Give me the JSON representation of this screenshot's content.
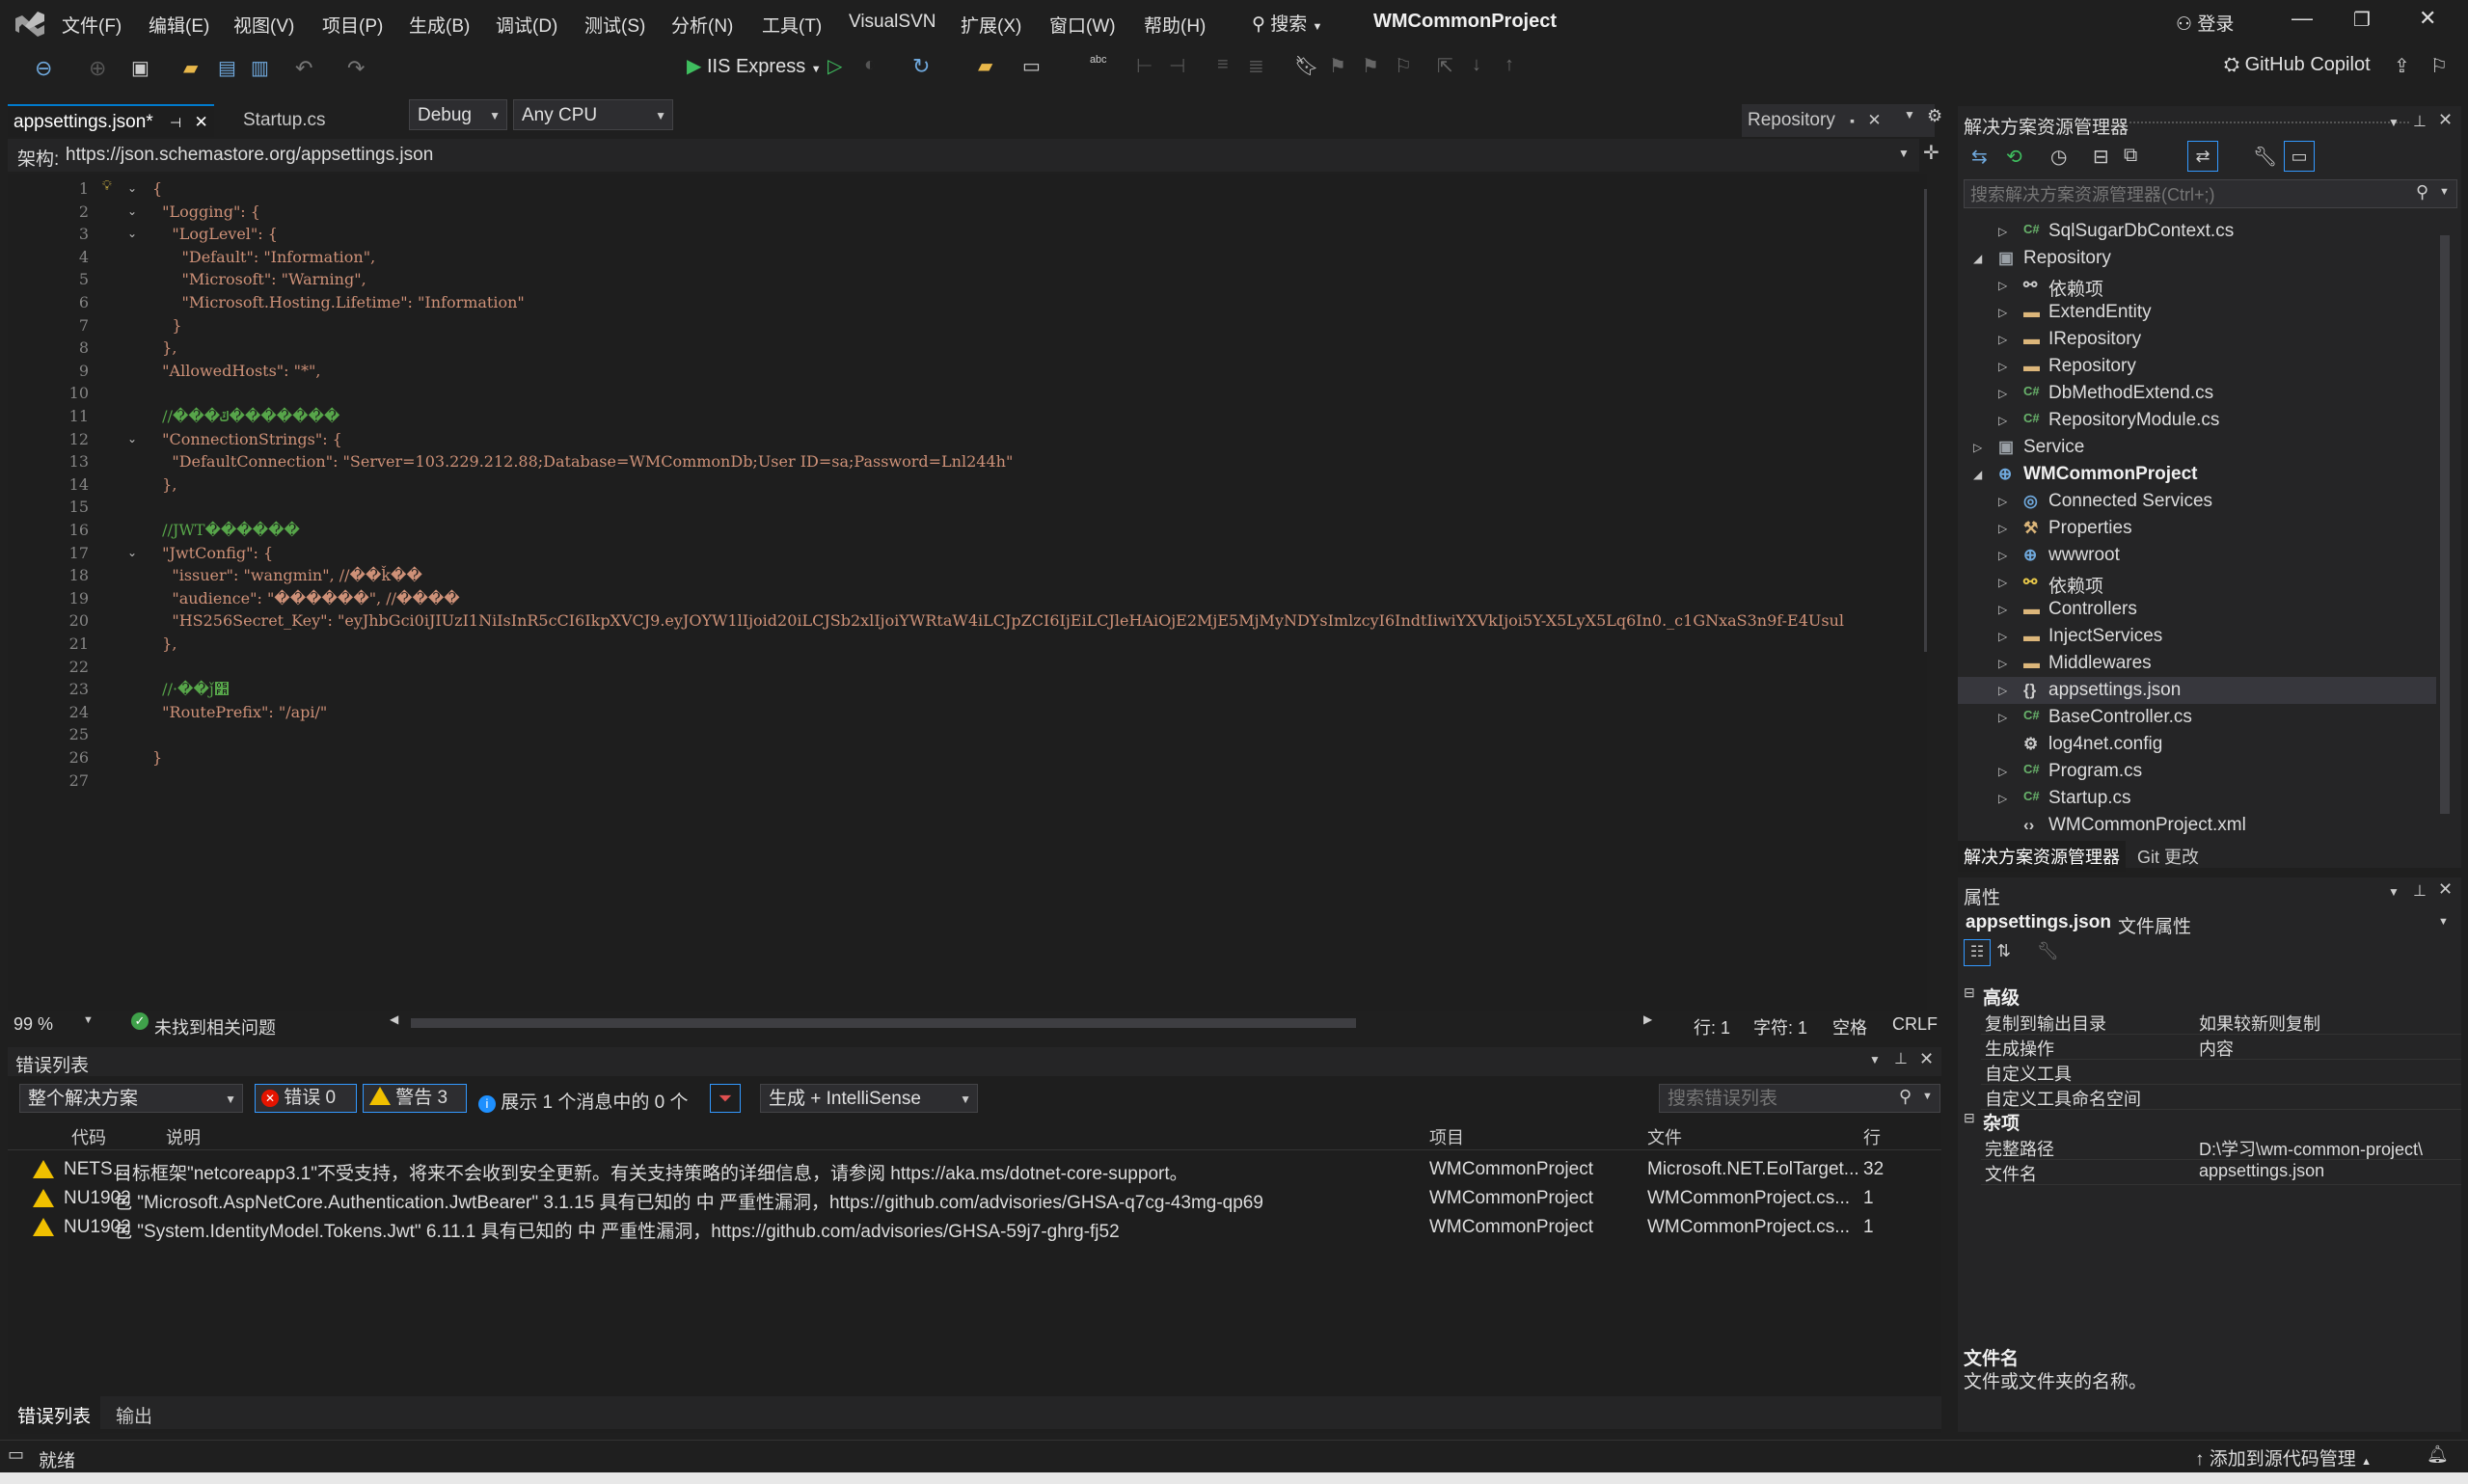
{
  "menu": [
    "文件(F)",
    "编辑(E)",
    "视图(V)",
    "项目(P)",
    "生成(B)",
    "调试(D)",
    "测试(S)",
    "分析(N)",
    "工具(T)",
    "VisualSVN",
    "扩展(X)",
    "窗口(W)",
    "帮助(H)"
  ],
  "search_label": "搜索",
  "project_title": "WMCommonProject",
  "login_label": "登录",
  "copilot_label": "GitHub Copilot",
  "toolbar": {
    "config": "Debug",
    "platform": "Any CPU",
    "run_target": "IIS Express"
  },
  "editor": {
    "tabs": [
      {
        "label": "appsettings.json*",
        "active": true
      },
      {
        "label": "Startup.cs",
        "active": false
      }
    ],
    "repository_label": "Repository",
    "schema_label": "架构:",
    "schema_url": "https://json.schemastore.org/appsettings.json",
    "lines": [
      {
        "n": "1",
        "text": "{",
        "cls": ""
      },
      {
        "n": "2",
        "text": "  \"Logging\": {",
        "cls": ""
      },
      {
        "n": "3",
        "text": "    \"LogLevel\": {",
        "cls": ""
      },
      {
        "n": "4",
        "text": "      \"Default\": \"Information\",",
        "cls": ""
      },
      {
        "n": "5",
        "text": "      \"Microsoft\": \"Warning\",",
        "cls": ""
      },
      {
        "n": "6",
        "text": "      \"Microsoft.Hosting.Lifetime\": \"Information\"",
        "cls": ""
      },
      {
        "n": "7",
        "text": "    }",
        "cls": ""
      },
      {
        "n": "8",
        "text": "  },",
        "cls": ""
      },
      {
        "n": "9",
        "text": "  \"AllowedHosts\": \"*\",",
        "cls": ""
      },
      {
        "n": "10",
        "text": "",
        "cls": ""
      },
      {
        "n": "11",
        "text": "  //���ݿ�������",
        "cls": "c"
      },
      {
        "n": "12",
        "text": "  \"ConnectionStrings\": {",
        "cls": ""
      },
      {
        "n": "13",
        "text": "    \"DefaultConnection\": \"Server=103.229.212.88;Database=WMCommonDb;User ID=sa;Password=Lnl244h\"",
        "cls": ""
      },
      {
        "n": "14",
        "text": "  },",
        "cls": ""
      },
      {
        "n": "15",
        "text": "",
        "cls": ""
      },
      {
        "n": "16",
        "text": "  //JWT������",
        "cls": "c"
      },
      {
        "n": "17",
        "text": "  \"JwtConfig\": {",
        "cls": ""
      },
      {
        "n": "18",
        "text": "    \"issuer\": \"wangmin\", //��ǩ��",
        "cls": ""
      },
      {
        "n": "19",
        "text": "    \"audience\": \"������\", //����",
        "cls": ""
      },
      {
        "n": "20",
        "text": "    \"HS256Secret_Key\": \"eyJhbGci0iJIUzI1NiIsInR5cCI6IkpXVCJ9.eyJOYW1lIjoid20iLCJSb2xlIjoiYWRtaW4iLCJpZCI6IjEiLCJleHAiOjE2MjE5MjMyNDYsImlzcyI6IndtIiwiYXVkIjoi5Y-X5LyX5Lq6In0._c1GNxaS3n9f-E4Usul",
        "cls": ""
      },
      {
        "n": "21",
        "text": "  },",
        "cls": ""
      },
      {
        "n": "22",
        "text": "",
        "cls": ""
      },
      {
        "n": "23",
        "text": "  //·��ǰ׺",
        "cls": "c"
      },
      {
        "n": "24",
        "text": "  \"RoutePrefix\": \"/api/\"",
        "cls": ""
      },
      {
        "n": "25",
        "text": "",
        "cls": ""
      },
      {
        "n": "26",
        "text": "}",
        "cls": ""
      },
      {
        "n": "27",
        "text": "",
        "cls": ""
      }
    ],
    "zoom": "99 %",
    "issues_label": "未找到相关问题",
    "line_col": "行: 1",
    "char_col": "字符: 1",
    "spacing": "空格",
    "eol": "CRLF"
  },
  "error_list": {
    "title": "错误列表",
    "scope": "整个解决方案",
    "errors_btn": "错误 0",
    "warnings_btn": "警告 3",
    "messages_label": "展示 1 个消息中的 0 个",
    "build_filter": "生成 + IntelliSense",
    "search_placeholder": "搜索错误列表",
    "columns": [
      "代码",
      "说明",
      "项目",
      "文件",
      "行"
    ],
    "rows": [
      {
        "code": "NETS...",
        "desc": "目标框架\"netcoreapp3.1\"不受支持，将来不会收到安全更新。有关支持策略的详细信息，请参阅 https://aka.ms/dotnet-core-support。",
        "project": "WMCommonProject",
        "file": "Microsoft.NET.EolTarget...",
        "line": "32"
      },
      {
        "code": "NU1902",
        "desc": "包 \"Microsoft.AspNetCore.Authentication.JwtBearer\" 3.1.15 具有已知的 中 严重性漏洞，https://github.com/advisories/GHSA-q7cg-43mg-qp69",
        "project": "WMCommonProject",
        "file": "WMCommonProject.cs...",
        "line": "1"
      },
      {
        "code": "NU1902",
        "desc": "包 \"System.IdentityModel.Tokens.Jwt\" 6.11.1 具有已知的 中 严重性漏洞，https://github.com/advisories/GHSA-59j7-ghrg-fj52",
        "project": "WMCommonProject",
        "file": "WMCommonProject.cs...",
        "line": "1"
      }
    ],
    "bottom_tabs": [
      "错误列表",
      "输出"
    ]
  },
  "solution_explorer": {
    "title": "解决方案资源管理器",
    "search_placeholder": "搜索解决方案资源管理器(Ctrl+;)",
    "items": [
      {
        "label": "SqlSugarDbContext.cs",
        "indent": 2,
        "icon": "csharp-file-icon",
        "expand": "right"
      },
      {
        "label": "Repository",
        "indent": 1,
        "icon": "csharp-project-icon",
        "expand": "down"
      },
      {
        "label": "依赖项",
        "indent": 2,
        "icon": "dependencies-icon",
        "expand": "right"
      },
      {
        "label": "ExtendEntity",
        "indent": 2,
        "icon": "folder-icon",
        "expand": "right"
      },
      {
        "label": "IRepository",
        "indent": 2,
        "icon": "folder-icon",
        "expand": "right"
      },
      {
        "label": "Repository",
        "indent": 2,
        "icon": "folder-icon",
        "expand": "right"
      },
      {
        "label": "DbMethodExtend.cs",
        "indent": 2,
        "icon": "csharp-file-icon",
        "expand": "right"
      },
      {
        "label": "RepositoryModule.cs",
        "indent": 2,
        "icon": "csharp-file-icon",
        "expand": "right"
      },
      {
        "label": "Service",
        "indent": 1,
        "icon": "csharp-project-icon",
        "expand": "right"
      },
      {
        "label": "WMCommonProject",
        "indent": 1,
        "icon": "web-project-icon",
        "expand": "down",
        "bold": true
      },
      {
        "label": "Connected Services",
        "indent": 2,
        "icon": "connected-services-icon",
        "expand": "right"
      },
      {
        "label": "Properties",
        "indent": 2,
        "icon": "properties-icon",
        "expand": "right"
      },
      {
        "label": "wwwroot",
        "indent": 2,
        "icon": "globe-icon",
        "expand": "right"
      },
      {
        "label": "依赖项",
        "indent": 2,
        "icon": "dependencies-warning-icon",
        "expand": "right"
      },
      {
        "label": "Controllers",
        "indent": 2,
        "icon": "folder-icon",
        "expand": "right"
      },
      {
        "label": "InjectServices",
        "indent": 2,
        "icon": "folder-icon",
        "expand": "right"
      },
      {
        "label": "Middlewares",
        "indent": 2,
        "icon": "folder-icon",
        "expand": "right"
      },
      {
        "label": "appsettings.json",
        "indent": 2,
        "icon": "json-file-icon",
        "expand": "right",
        "selected": true
      },
      {
        "label": "BaseController.cs",
        "indent": 2,
        "icon": "csharp-file-icon",
        "expand": "right"
      },
      {
        "label": "log4net.config",
        "indent": 2,
        "icon": "config-file-icon",
        "expand": ""
      },
      {
        "label": "Program.cs",
        "indent": 2,
        "icon": "csharp-file-icon",
        "expand": "right"
      },
      {
        "label": "Startup.cs",
        "indent": 2,
        "icon": "csharp-file-icon",
        "expand": "right"
      },
      {
        "label": "WMCommonProject.xml",
        "indent": 2,
        "icon": "xml-file-icon",
        "expand": ""
      }
    ],
    "tabs": [
      "解决方案资源管理器",
      "Git 更改"
    ]
  },
  "properties": {
    "title": "属性",
    "object": "appsettings.json",
    "object_type": "文件属性",
    "sections": [
      {
        "name": "高级",
        "rows": [
          {
            "key": "复制到输出目录",
            "value": "如果较新则复制"
          },
          {
            "key": "生成操作",
            "value": "内容"
          },
          {
            "key": "自定义工具",
            "value": ""
          },
          {
            "key": "自定义工具命名空间",
            "value": ""
          }
        ]
      },
      {
        "name": "杂项",
        "rows": [
          {
            "key": "完整路径",
            "value": "D:\\学习\\wm-common-project\\"
          },
          {
            "key": "文件名",
            "value": "appsettings.json"
          }
        ]
      }
    ],
    "desc_title": "文件名",
    "desc_text": "文件或文件夹的名称。"
  },
  "status": {
    "ready": "就绪",
    "source_control": "添加到源代码管理"
  }
}
